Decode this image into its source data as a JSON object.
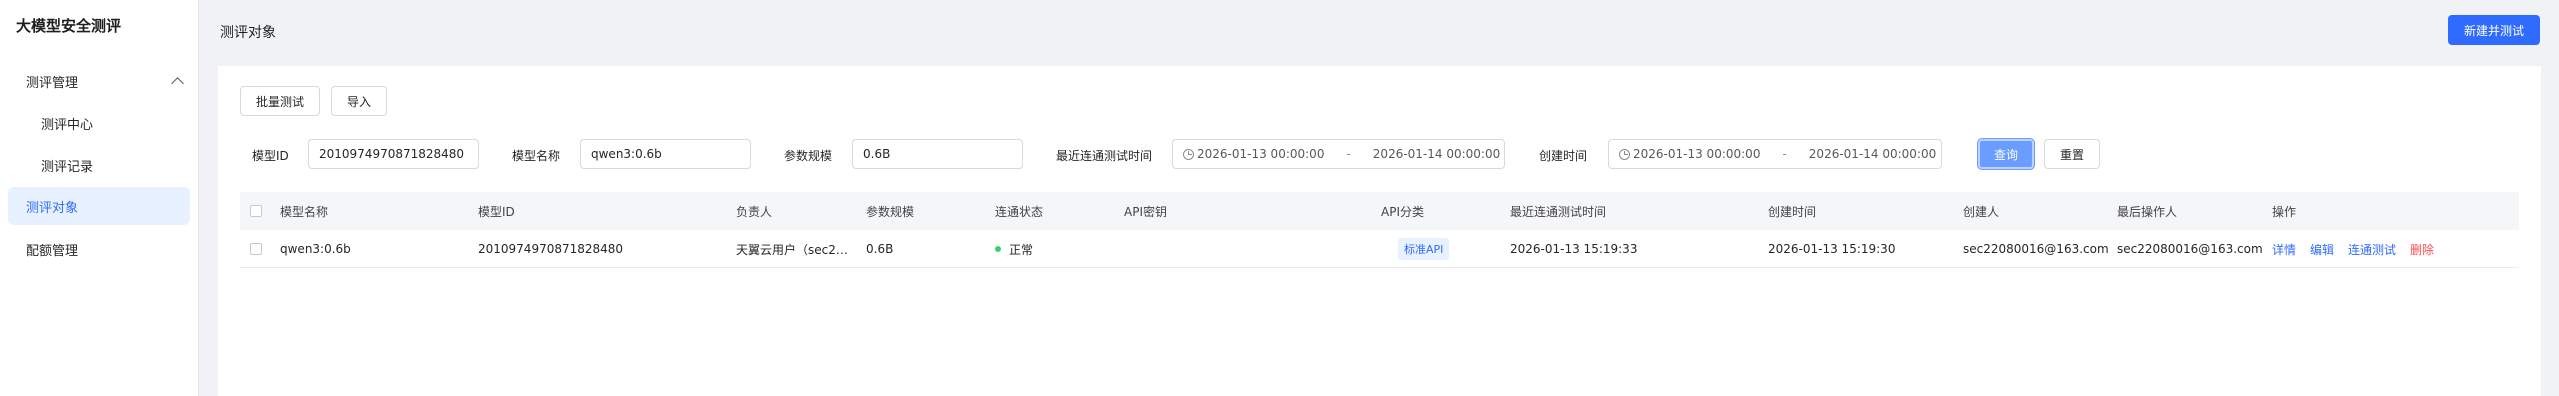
{
  "sidebar": {
    "brand": "大模型安全测评",
    "group_label": "测评管理",
    "sub_items": [
      "测评中心",
      "测评记录"
    ],
    "active_item": "测评对象",
    "other_item": "配额管理"
  },
  "header": {
    "title": "测评对象",
    "create_button": "新建并测试"
  },
  "toolbar": {
    "batch_test": "批量测试",
    "import": "导入"
  },
  "filters": {
    "model_id_label": "模型ID",
    "model_id_value": "2010974970871828480",
    "model_name_label": "模型名称",
    "model_name_value": "qwen3:0.6b",
    "param_label": "参数规模",
    "param_value": "0.6B",
    "last_test_label": "最近连通测试时间",
    "last_test_start": "2026-01-13 00:00:00",
    "last_test_end": "2026-01-14 00:00:00",
    "created_label": "创建时间",
    "created_start": "2026-01-13 00:00:00",
    "created_end": "2026-01-14 00:00:00",
    "range_sep": "-",
    "query_button": "查询",
    "reset_button": "重置"
  },
  "table": {
    "columns": [
      "模型名称",
      "模型ID",
      "负责人",
      "参数规模",
      "连通状态",
      "API密钥",
      "API分类",
      "最近连通测试时间",
      "创建时间",
      "创建人",
      "最后操作人",
      "操作"
    ],
    "rows": [
      {
        "name": "qwen3:0.6b",
        "id": "2010974970871828480",
        "owner": "天翼云用户（sec2…",
        "params": "0.6B",
        "status": "正常",
        "api_key": "",
        "api_type": "标准API",
        "last_test": "2026-01-13 15:19:33",
        "created": "2026-01-13 15:19:30",
        "creator": "sec22080016@163.com",
        "last_operator": "sec22080016@163.com",
        "actions": [
          "详情",
          "编辑",
          "连通测试",
          "删除"
        ]
      }
    ]
  },
  "colors": {
    "primary": "#2f6bff",
    "danger": "#ff4d4f",
    "success": "#3ccf6e"
  }
}
